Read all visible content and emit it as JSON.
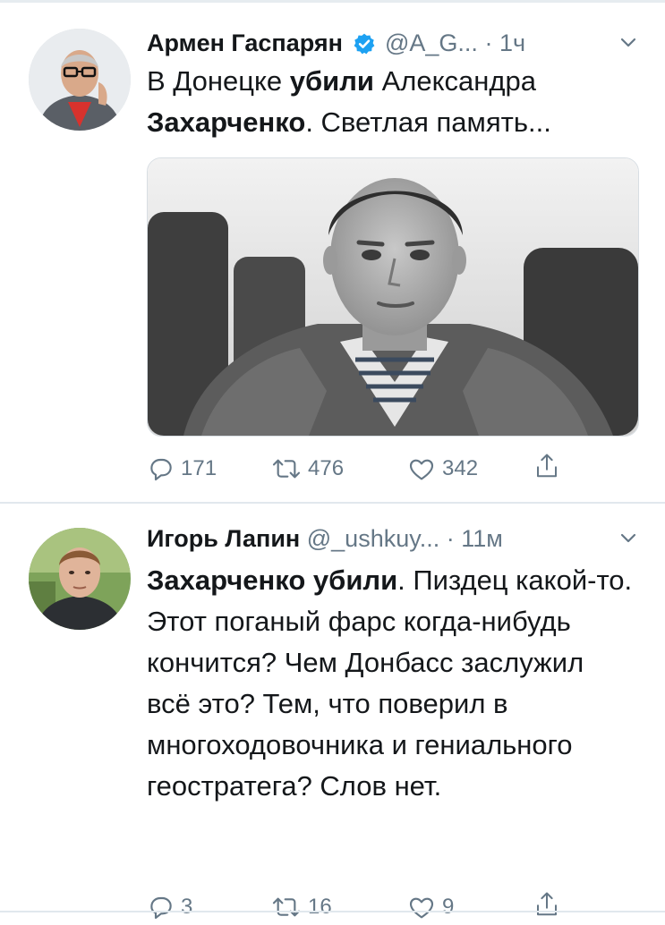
{
  "tweets": [
    {
      "author_name": "Армен Гаспарян",
      "handle": "@A_G...",
      "separator": "·",
      "time": "1ч",
      "text_parts": [
        {
          "t": "В Донецке ",
          "bold": false
        },
        {
          "t": "убили",
          "bold": true
        },
        {
          "t": " Александра ",
          "bold": false
        },
        {
          "t": "Захарченко",
          "bold": true
        },
        {
          "t": ". Светлая память...",
          "bold": false
        }
      ],
      "actions": {
        "replies": "171",
        "retweets": "476",
        "likes": "342"
      }
    },
    {
      "author_name": "Игорь Лапин",
      "handle": "@_ushkuy...",
      "separator": "·",
      "time": "11м",
      "text_parts": [
        {
          "t": "Захарченко убили",
          "bold": true
        },
        {
          "t": ". Пиздец какой-то. Этот поганый фарс когда-нибудь кончится? Чем Донбасс заслужил всё это? Тем, что поверил в многоходовочника и гениального геостратега? Слов нет.",
          "bold": false
        }
      ],
      "actions": {
        "replies": "3",
        "retweets": "16",
        "likes": "9"
      }
    }
  ],
  "colors": {
    "accent": "#1da1f2",
    "secondary_text": "#657786",
    "divider": "#e1e8ed"
  },
  "icons": [
    "verified-badge-icon",
    "chevron-down-icon",
    "reply-icon",
    "retweet-icon",
    "like-icon",
    "share-icon"
  ]
}
